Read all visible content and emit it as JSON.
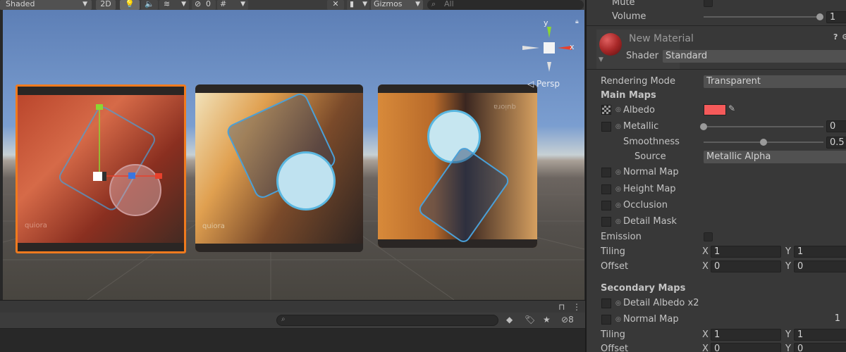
{
  "scene_toolbar": {
    "shading_mode": "Shaded",
    "view_2d_label": "2D",
    "hidden_count": "0",
    "gizmos_label": "Gizmos",
    "search_placeholder": "All"
  },
  "scene_view": {
    "projection_label": "Persp",
    "axis_labels": {
      "y": "y",
      "x": "x"
    },
    "card_brand_text": "quiora"
  },
  "inspector": {
    "audio": {
      "mute_label": "Mute",
      "mute_checked": false,
      "volume_label": "Volume",
      "volume_value": "1",
      "volume_fraction": 1.0
    },
    "material": {
      "name": "New Material",
      "shader_label": "Shader",
      "shader_value": "Standard",
      "help_icon_text": "?"
    },
    "rendering_mode_label": "Rendering Mode",
    "rendering_mode_value": "Transparent",
    "main_maps": {
      "header": "Main Maps",
      "albedo_label": "Albedo",
      "albedo_color": "#f55a5a",
      "metallic_label": "Metallic",
      "metallic_value": "0",
      "metallic_fraction": 0.0,
      "smoothness_label": "Smoothness",
      "smoothness_value": "0.5",
      "smoothness_fraction": 0.5,
      "source_label": "Source",
      "source_value": "Metallic Alpha",
      "normal_map_label": "Normal Map",
      "height_map_label": "Height Map",
      "occlusion_label": "Occlusion",
      "detail_mask_label": "Detail Mask",
      "emission_label": "Emission",
      "tiling_label": "Tiling",
      "tiling_x": "1",
      "tiling_y": "1",
      "offset_label": "Offset",
      "offset_x": "0",
      "offset_y": "0",
      "x_label": "X",
      "y_label": "Y"
    },
    "secondary_maps": {
      "header": "Secondary Maps",
      "detail_albedo_label": "Detail Albedo x2",
      "normal_map_label": "Normal Map",
      "normal_map_value": "1",
      "tiling_label": "Tiling",
      "tiling_x": "1",
      "tiling_y": "1",
      "offset_label": "Offset",
      "offset_x": "0",
      "offset_y": "0"
    }
  },
  "bottom_panel": {
    "hidden_count": "8"
  },
  "colors": {
    "selection_outline": "#f07a1e",
    "x_axis": "#e8412c",
    "y_axis": "#8cd631",
    "z_axis": "#3a76e0"
  }
}
